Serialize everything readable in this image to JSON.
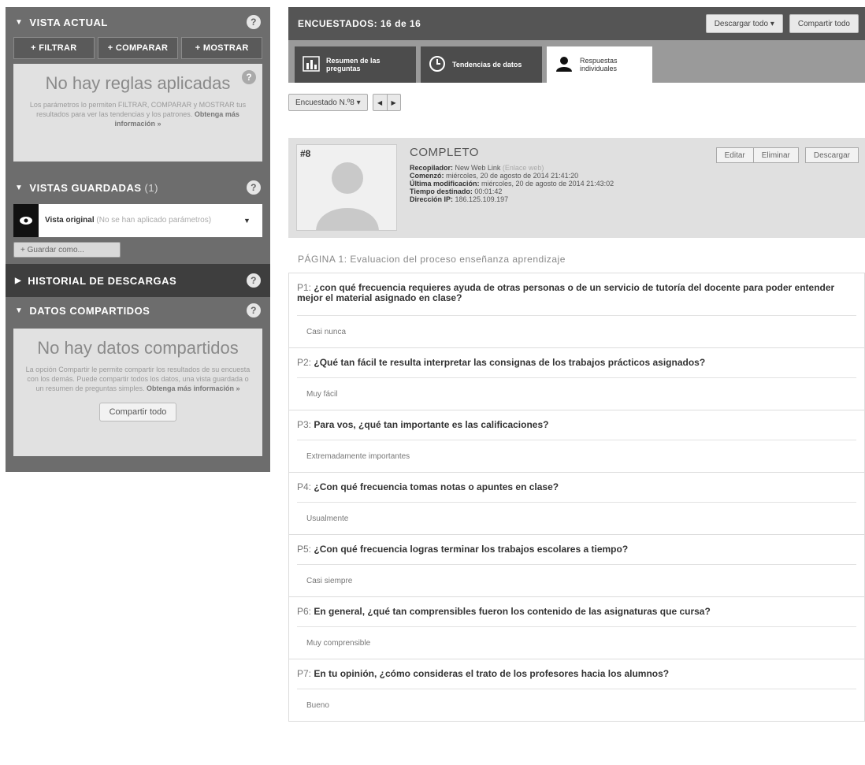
{
  "sidebar": {
    "current_view": {
      "title": "VISTA ACTUAL",
      "buttons": [
        "+ FILTRAR",
        "+ COMPARAR",
        "+ MOSTRAR"
      ],
      "empty_title": "No hay reglas aplicadas",
      "empty_text": "Los parámetros lo permiten FILTRAR, COMPARAR y MOSTRAR tus resultados para ver las tendencias y los patrones.",
      "empty_link": "Obtenga más información »"
    },
    "saved_views": {
      "title": "VISTAS GUARDADAS",
      "count": "(1)",
      "item_name": "Vista original",
      "item_note": "(No se han aplicado parámetros)",
      "save_as": "+ Guardar como..."
    },
    "download_history": {
      "title": "HISTORIAL DE DESCARGAS"
    },
    "shared_data": {
      "title": "DATOS COMPARTIDOS",
      "empty_title": "No hay datos compartidos",
      "empty_text": "La opción Compartir le permite compartir los resultados de su encuesta con los demás. Puede compartir todos los datos, una vista guardada o un resumen de preguntas simples.",
      "empty_link": "Obtenga más información »",
      "share_button": "Compartir todo"
    }
  },
  "topbar": {
    "title": "ENCUESTADOS: 16 de 16",
    "download_all": "Descargar todo ▾",
    "share_all": "Compartir todo"
  },
  "tabs": [
    {
      "label": "Resumen de las preguntas",
      "icon": "bar-chart-icon"
    },
    {
      "label": "Tendencias de datos",
      "icon": "clock-icon"
    },
    {
      "label": "Respuestas individuales",
      "icon": "person-icon"
    }
  ],
  "respondent_nav": {
    "selector": "Encuestado N.º8 ▾",
    "prev": "◀",
    "next": "▶"
  },
  "respondent": {
    "number": "#8",
    "status": "COMPLETO",
    "collector_label": "Recopilador:",
    "collector_value": "New Web Link",
    "collector_note": "(Enlace web)",
    "started_label": "Comenzó:",
    "started_value": "miércoles, 20 de agosto de 2014 21:41:20",
    "modified_label": "Última modificación:",
    "modified_value": "miércoles, 20 de agosto de 2014 21:43:02",
    "time_label": "Tiempo destinado:",
    "time_value": "00:01:42",
    "ip_label": "Dirección IP:",
    "ip_value": "186.125.109.197",
    "edit": "Editar",
    "delete": "Eliminar",
    "download": "Descargar"
  },
  "page_title": "PÁGINA 1: Evaluacion del proceso enseñanza aprendizaje",
  "questions": [
    {
      "num": "P1:",
      "text": "¿con qué frecuencia requieres ayuda de otras personas o de un servicio de tutoría del docente para poder entender mejor el material asignado en clase?",
      "answer": "Casi nunca"
    },
    {
      "num": "P2:",
      "text": "¿Qué tan fácil te resulta interpretar las consignas de los trabajos prácticos asignados?",
      "answer": "Muy fácil"
    },
    {
      "num": "P3:",
      "text": "Para vos, ¿qué tan importante es las calificaciones?",
      "answer": "Extremadamente importantes"
    },
    {
      "num": "P4:",
      "text": "¿Con qué frecuencia tomas notas o apuntes en clase?",
      "answer": "Usualmente"
    },
    {
      "num": "P5:",
      "text": "¿Con qué frecuencia logras terminar los trabajos escolares a tiempo?",
      "answer": "Casi siempre"
    },
    {
      "num": "P6:",
      "text": "En general, ¿qué tan comprensibles fueron los contenido de las asignaturas que cursa?",
      "answer": "Muy comprensible"
    },
    {
      "num": "P7:",
      "text": "En tu opinión, ¿cómo consideras el trato de los profesores hacia los alumnos?",
      "answer": "Bueno"
    }
  ]
}
